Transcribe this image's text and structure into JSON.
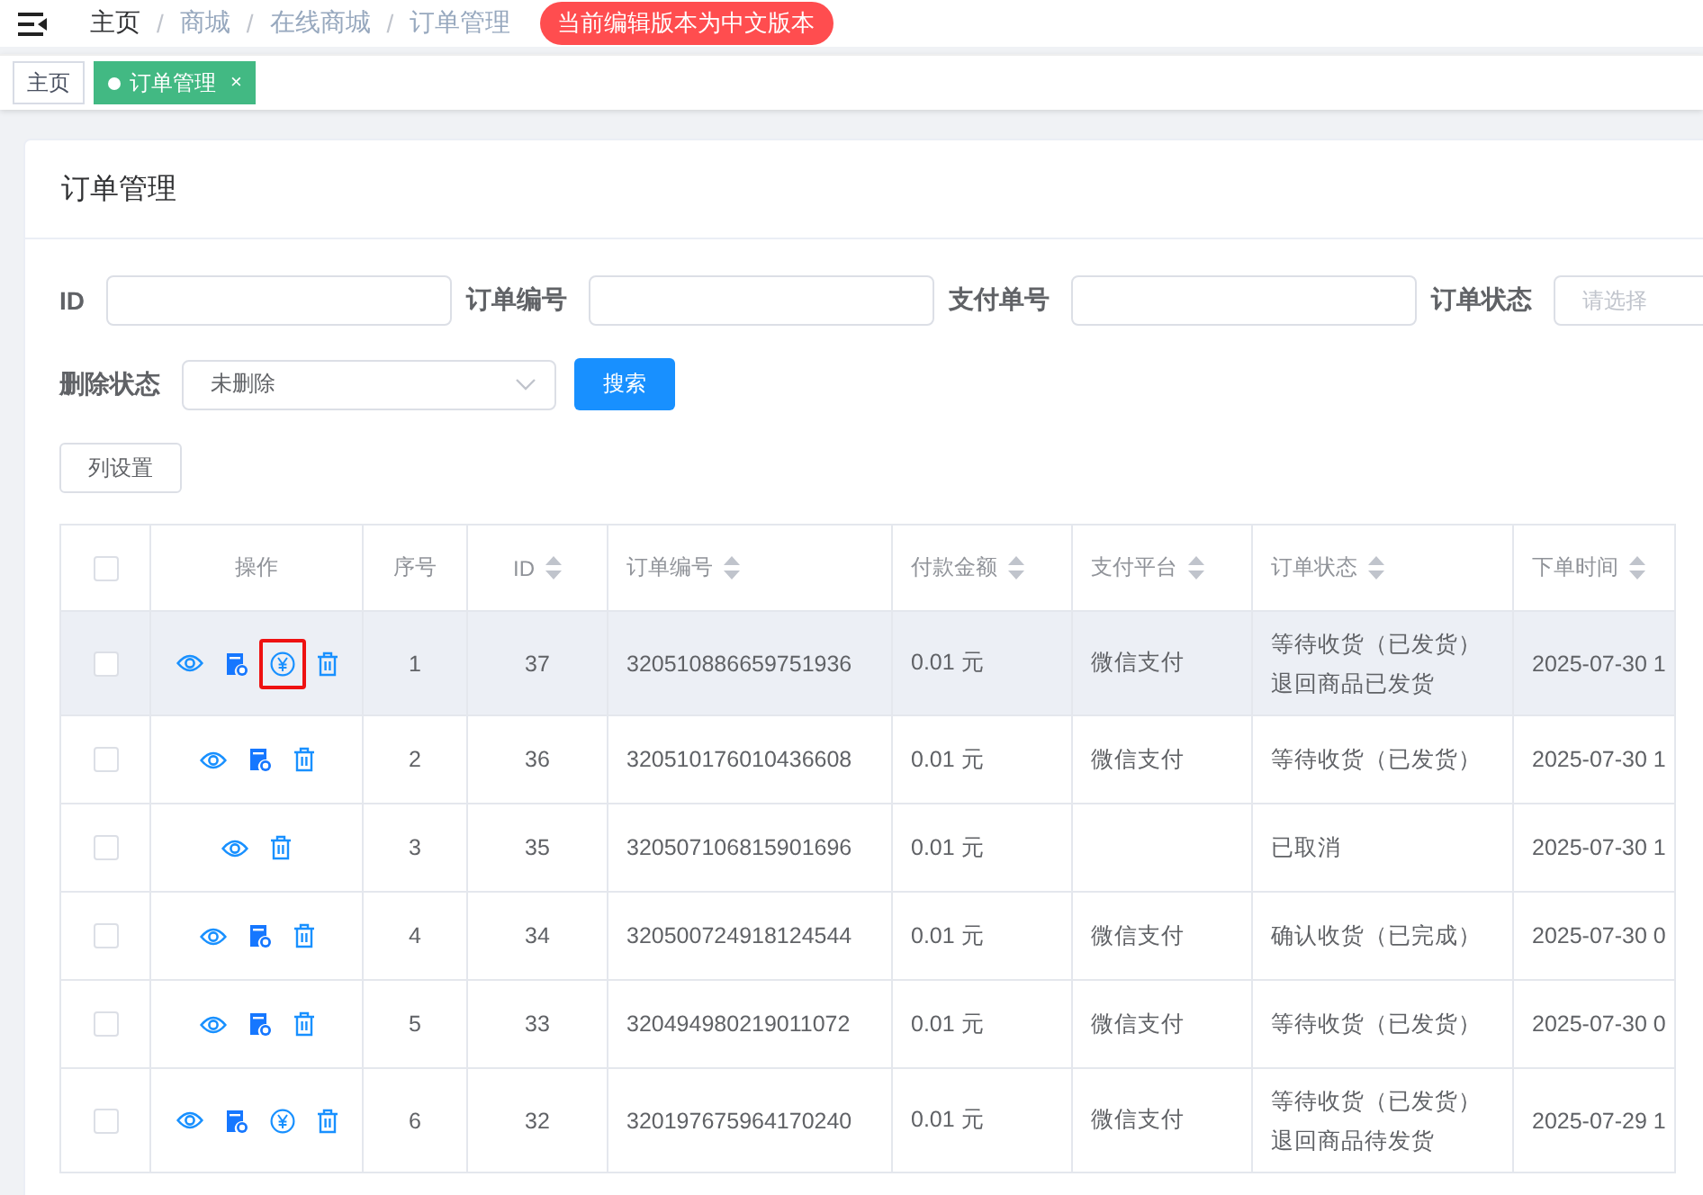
{
  "topbar": {
    "breadcrumb": [
      "主页",
      "商城",
      "在线商城",
      "订单管理"
    ],
    "separator": "/",
    "badge": "当前编辑版本为中文版本"
  },
  "tabs": [
    {
      "label": "主页",
      "selected": false
    },
    {
      "label": "订单管理",
      "selected": true,
      "close": "×"
    }
  ],
  "card": {
    "title": "订单管理"
  },
  "filter_rows": [
    [
      {
        "label": "ID",
        "kind": "input"
      },
      {
        "label": "订单编号",
        "kind": "input"
      },
      {
        "label": "支付单号",
        "kind": "input"
      },
      {
        "label": "订单状态",
        "kind": "select",
        "placeholder": "请选择"
      }
    ],
    [
      {
        "label": "删除状态",
        "kind": "select",
        "value": "未删除"
      }
    ]
  ],
  "search_button": "搜索",
  "column_settings_button": "列设置",
  "table": {
    "columns": [
      {
        "kind": "checkbox",
        "checked": false
      },
      {
        "kind": "text",
        "label": "操作",
        "sortable": false
      },
      {
        "kind": "text",
        "label": "序号",
        "sortable": false
      },
      {
        "kind": "text",
        "label": "ID",
        "sortable": true
      },
      {
        "kind": "text",
        "label": "订单编号",
        "sortable": true
      },
      {
        "kind": "text",
        "label": "付款金额",
        "sortable": true
      },
      {
        "kind": "text",
        "label": "支付平台",
        "sortable": true
      },
      {
        "kind": "text",
        "label": "订单状态",
        "sortable": true
      },
      {
        "kind": "text",
        "label": "下单时间",
        "sortable": true
      }
    ],
    "rows": [
      {
        "checked": false,
        "highlighted": true,
        "actions": [
          {
            "kind": "view",
            "marked": false
          },
          {
            "kind": "edit",
            "marked": false
          },
          {
            "kind": "pay",
            "marked": true
          },
          {
            "kind": "delete",
            "marked": false
          }
        ],
        "seq": "1",
        "id": "37",
        "order_no": "320510886659751936",
        "amount": "0.01 元",
        "platform": "微信支付",
        "status": [
          "等待收货（已发货）",
          "退回商品已发货"
        ],
        "time": "2025-07-30 1"
      },
      {
        "checked": false,
        "highlighted": false,
        "actions": [
          {
            "kind": "view",
            "marked": false
          },
          {
            "kind": "edit",
            "marked": false
          },
          {
            "kind": "delete",
            "marked": false
          }
        ],
        "seq": "2",
        "id": "36",
        "order_no": "320510176010436608",
        "amount": "0.01 元",
        "platform": "微信支付",
        "status": [
          "等待收货（已发货）"
        ],
        "time": "2025-07-30 1"
      },
      {
        "checked": false,
        "highlighted": false,
        "actions": [
          {
            "kind": "view",
            "marked": false
          },
          {
            "kind": "delete",
            "marked": false
          }
        ],
        "seq": "3",
        "id": "35",
        "order_no": "320507106815901696",
        "amount": "0.01 元",
        "status": [
          "已取消"
        ],
        "time": "2025-07-30 1"
      },
      {
        "checked": false,
        "highlighted": false,
        "actions": [
          {
            "kind": "view",
            "marked": false
          },
          {
            "kind": "edit",
            "marked": false
          },
          {
            "kind": "delete",
            "marked": false
          }
        ],
        "seq": "4",
        "id": "34",
        "order_no": "320500724918124544",
        "amount": "0.01 元",
        "platform": "微信支付",
        "status": [
          "确认收货（已完成）"
        ],
        "time": "2025-07-30 0"
      },
      {
        "checked": false,
        "highlighted": false,
        "actions": [
          {
            "kind": "view",
            "marked": false
          },
          {
            "kind": "edit",
            "marked": false
          },
          {
            "kind": "delete",
            "marked": false
          }
        ],
        "seq": "5",
        "id": "33",
        "order_no": "320494980219011072",
        "amount": "0.01 元",
        "platform": "微信支付",
        "status": [
          "等待收货（已发货）"
        ],
        "time": "2025-07-30 0"
      },
      {
        "checked": false,
        "highlighted": false,
        "actions": [
          {
            "kind": "view",
            "marked": false
          },
          {
            "kind": "edit",
            "marked": false
          },
          {
            "kind": "pay",
            "marked": false
          },
          {
            "kind": "delete",
            "marked": false
          }
        ],
        "seq": "6",
        "id": "32",
        "order_no": "320197675964170240",
        "amount": "0.01 元",
        "platform": "微信支付",
        "status": [
          "等待收货（已发货）",
          "退回商品待发货"
        ],
        "time": "2025-07-29 1"
      }
    ]
  }
}
